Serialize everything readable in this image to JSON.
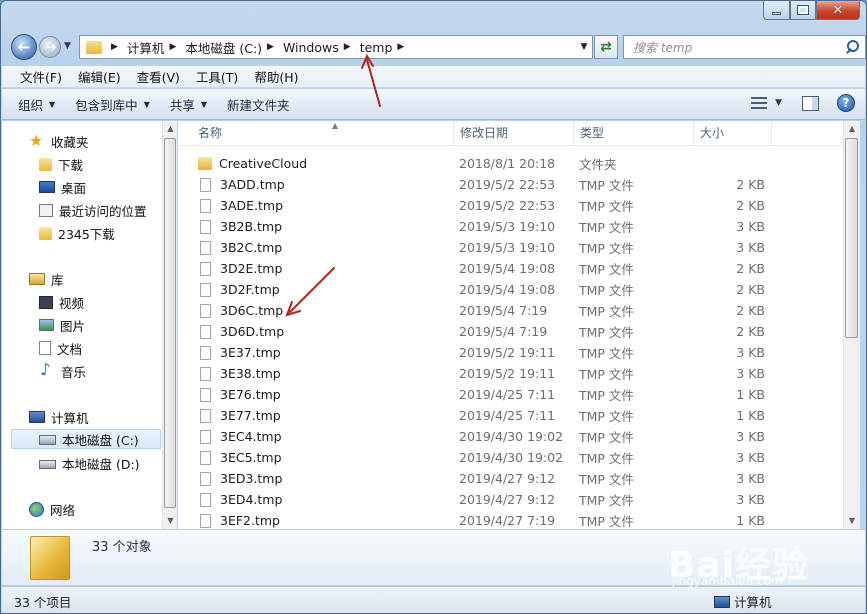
{
  "window": {
    "colors": {
      "titlebar": "#c5daf0",
      "close": "#c7462d",
      "selection": "#d7e8f8"
    }
  },
  "address": {
    "crumbs": [
      "计算机",
      "本地磁盘 (C:)",
      "Windows",
      "temp"
    ],
    "search_placeholder": "搜索 temp"
  },
  "menu": [
    "文件(F)",
    "编辑(E)",
    "查看(V)",
    "工具(T)",
    "帮助(H)"
  ],
  "toolbar": {
    "organize": "组织",
    "include": "包含到库中",
    "share": "共享",
    "new_folder": "新建文件夹"
  },
  "navpane": {
    "favorites": "收藏夹",
    "fav_items": [
      "下载",
      "桌面",
      "最近访问的位置",
      "2345下载"
    ],
    "libraries": "库",
    "lib_items": [
      "视频",
      "图片",
      "文档",
      "音乐"
    ],
    "computer": "计算机",
    "drives": [
      "本地磁盘 (C:)",
      "本地磁盘 (D:)"
    ],
    "network": "网络"
  },
  "columns": {
    "name": "名称",
    "date": "修改日期",
    "type": "类型",
    "size": "大小"
  },
  "files": [
    {
      "name": "CreativeCloud",
      "date": "2018/8/1 20:18",
      "type": "文件夹",
      "size": "",
      "folder": true
    },
    {
      "name": "3ADD.tmp",
      "date": "2019/5/2 22:53",
      "type": "TMP 文件",
      "size": "2 KB"
    },
    {
      "name": "3ADE.tmp",
      "date": "2019/5/2 22:53",
      "type": "TMP 文件",
      "size": "2 KB"
    },
    {
      "name": "3B2B.tmp",
      "date": "2019/5/3 19:10",
      "type": "TMP 文件",
      "size": "3 KB"
    },
    {
      "name": "3B2C.tmp",
      "date": "2019/5/3 19:10",
      "type": "TMP 文件",
      "size": "3 KB"
    },
    {
      "name": "3D2E.tmp",
      "date": "2019/5/4 19:08",
      "type": "TMP 文件",
      "size": "2 KB"
    },
    {
      "name": "3D2F.tmp",
      "date": "2019/5/4 19:08",
      "type": "TMP 文件",
      "size": "2 KB"
    },
    {
      "name": "3D6C.tmp",
      "date": "2019/5/4 7:19",
      "type": "TMP 文件",
      "size": "2 KB"
    },
    {
      "name": "3D6D.tmp",
      "date": "2019/5/4 7:19",
      "type": "TMP 文件",
      "size": "2 KB"
    },
    {
      "name": "3E37.tmp",
      "date": "2019/5/2 19:11",
      "type": "TMP 文件",
      "size": "3 KB"
    },
    {
      "name": "3E38.tmp",
      "date": "2019/5/2 19:11",
      "type": "TMP 文件",
      "size": "3 KB"
    },
    {
      "name": "3E76.tmp",
      "date": "2019/4/25 7:11",
      "type": "TMP 文件",
      "size": "1 KB"
    },
    {
      "name": "3E77.tmp",
      "date": "2019/4/25 7:11",
      "type": "TMP 文件",
      "size": "1 KB"
    },
    {
      "name": "3EC4.tmp",
      "date": "2019/4/30 19:02",
      "type": "TMP 文件",
      "size": "3 KB"
    },
    {
      "name": "3EC5.tmp",
      "date": "2019/4/30 19:02",
      "type": "TMP 文件",
      "size": "3 KB"
    },
    {
      "name": "3ED3.tmp",
      "date": "2019/4/27 9:12",
      "type": "TMP 文件",
      "size": "3 KB"
    },
    {
      "name": "3ED4.tmp",
      "date": "2019/4/27 9:12",
      "type": "TMP 文件",
      "size": "3 KB"
    },
    {
      "name": "3EF2.tmp",
      "date": "2019/4/27 7:19",
      "type": "TMP 文件",
      "size": "1 KB"
    }
  ],
  "details": {
    "count": "33 个对象"
  },
  "status": {
    "left": "33 个项目",
    "right": "计算机"
  },
  "watermark": {
    "text": "Bai经验",
    "sub": "jingyan.baidu.com"
  }
}
